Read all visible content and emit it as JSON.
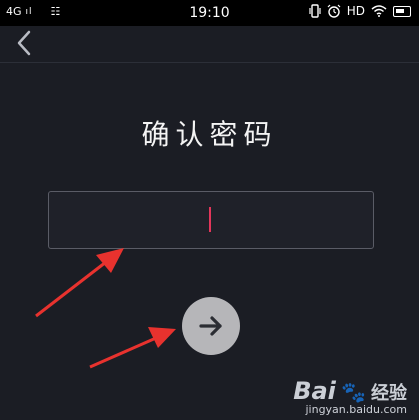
{
  "status_bar": {
    "network": "4G",
    "signal": "ıl",
    "grid_icon": "☷",
    "time": "19:10",
    "hd": "HD",
    "icons": [
      "vibrate-icon",
      "alarm-icon",
      "wifi-icon",
      "battery-icon"
    ]
  },
  "header": {
    "back_icon": "chevron-left-icon"
  },
  "page": {
    "title": "确认密码",
    "password_value": "",
    "next_icon": "arrow-right-icon"
  },
  "watermark": {
    "logo": "Bai",
    "logo_cn": "经验",
    "url": "jingyan.baidu.com"
  },
  "colors": {
    "background": "#1b1d24",
    "caret": "#e2365a",
    "button": "#b6b6b9",
    "annotation_arrow": "#e8322e"
  }
}
